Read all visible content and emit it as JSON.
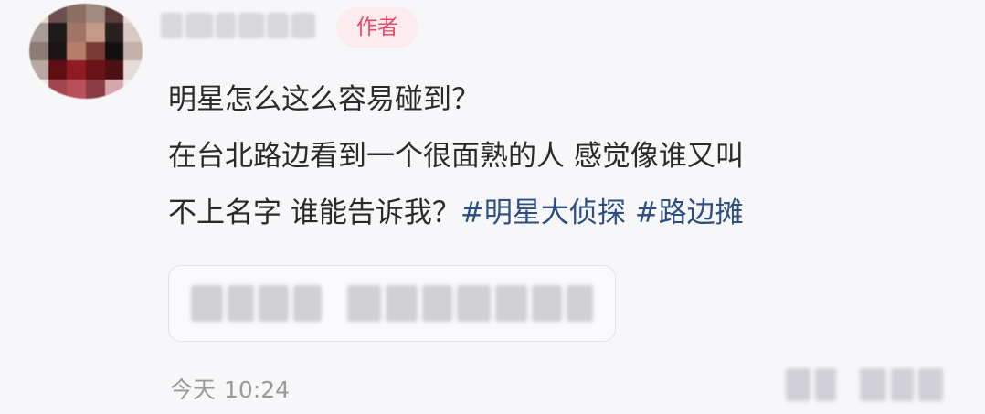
{
  "author_badge": "作者",
  "comment": {
    "line1": "明星怎么这么容易碰到？",
    "line2": "在台北路边看到一个很面熟的人 感觉像谁又叫",
    "line3_text": "不上名字 谁能告诉我？",
    "hashtags": [
      "#明星大侦探",
      "#路边摊"
    ]
  },
  "meta": {
    "date": "今天",
    "time": "10:24"
  },
  "colors": {
    "hashtag": "#2c4e80",
    "author_badge_text": "#ea4a63",
    "author_badge_bg": "#fcecef",
    "timestamp": "#9a9a9a"
  }
}
